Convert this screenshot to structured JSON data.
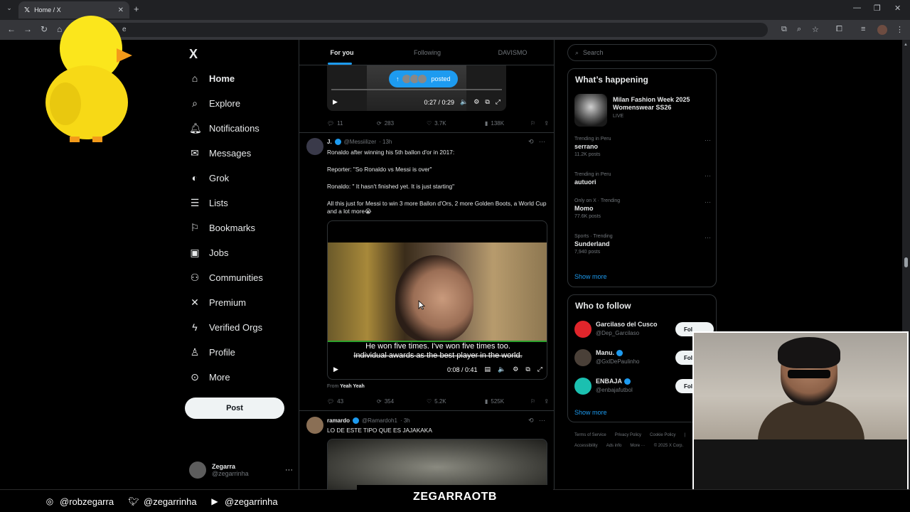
{
  "browser": {
    "tab_title": "Home / X",
    "tab_close": "✕",
    "new_tab": "+",
    "partial_url_text": "e"
  },
  "nav": {
    "logo": "X",
    "items": [
      {
        "label": "Home",
        "icon": "home-icon"
      },
      {
        "label": "Explore",
        "icon": "search-icon"
      },
      {
        "label": "Notifications",
        "icon": "bell-icon"
      },
      {
        "label": "Messages",
        "icon": "envelope-icon"
      },
      {
        "label": "Grok",
        "icon": "grok-icon"
      },
      {
        "label": "Lists",
        "icon": "list-icon"
      },
      {
        "label": "Bookmarks",
        "icon": "bookmark-icon"
      },
      {
        "label": "Jobs",
        "icon": "briefcase-icon"
      },
      {
        "label": "Communities",
        "icon": "people-icon"
      },
      {
        "label": "Premium",
        "icon": "x-icon"
      },
      {
        "label": "Verified Orgs",
        "icon": "lightning-icon"
      },
      {
        "label": "Profile",
        "icon": "person-icon"
      },
      {
        "label": "More",
        "icon": "more-circle-icon"
      }
    ],
    "post_button": "Post",
    "account": {
      "name": "Zegarra",
      "handle": "@zegarrinha",
      "more": "···"
    }
  },
  "timeline": {
    "tabs": [
      "For you",
      "Following",
      "DAVISMO"
    ],
    "active_tab": 0,
    "top_video": {
      "posted_label": "posted",
      "time": "0:27 / 0:29",
      "actions": {
        "replies": "11",
        "reposts": "283",
        "likes": "3.7K",
        "views": "138K"
      }
    },
    "tweet1": {
      "name": "J.",
      "handle": "@Messiilizer",
      "time": "· 13h",
      "text": [
        "Ronaldo after winning his 5th ballon d'or in 2017:",
        "Reporter: \"So Ronaldo vs Messi is over\"",
        "Ronaldo: \" It hasn't finished yet. It is just starting\"",
        "All this just for Messi to win 3 more Ballon d'Ors, 2 more Golden Boots, a World Cup and a lot more😭"
      ],
      "subtitle_1": "He won five times. I've won five times too.",
      "subtitle_2": "Individual awards as the best player in the world.",
      "video_time": "0:08 / 0:41",
      "from_prefix": "From",
      "from_name": "Yeah Yeah",
      "actions": {
        "replies": "43",
        "reposts": "354",
        "likes": "5.2K",
        "views": "525K"
      }
    },
    "tweet2": {
      "name": "ramardo",
      "handle": "@Ramardoh1",
      "time": "· 3h",
      "text": "LO DE ESTE TIPO QUE ES JAJAKAKA"
    }
  },
  "right": {
    "search_placeholder": "Search",
    "whats_happening_title": "What’s happening",
    "featured": {
      "title": "Milan Fashion Week 2025 Womenswear SS26",
      "status": "LIVE"
    },
    "trends": [
      {
        "context": "Trending in Peru",
        "title": "serrano",
        "count": "11.2K posts"
      },
      {
        "context": "Trending in Peru",
        "title": "autuori",
        "count": ""
      },
      {
        "context": "Only on X · Trending",
        "title": "Momo",
        "count": "77.6K posts"
      },
      {
        "context": "Sports · Trending",
        "title": "Sunderland",
        "count": "7,940 posts"
      }
    ],
    "show_more": "Show more",
    "who_to_follow_title": "Who to follow",
    "follow": [
      {
        "name": "Garcilaso del Cusco",
        "handle": "@Dep_Garcilaso",
        "verified": false,
        "color": "#e0252b"
      },
      {
        "name": "Manu.",
        "handle": "@GxlDePaulinho",
        "verified": true,
        "color": "#4a4038"
      },
      {
        "name": "ENBAJA",
        "handle": "@enbajafutbol",
        "verified": true,
        "color": "#1bc0b0"
      }
    ],
    "follow_label": "Fol",
    "footer": {
      "row1": [
        "Terms of Service",
        "Privacy Policy",
        "Cookie Policy",
        "|"
      ],
      "row2": [
        "Accessibility",
        "Ads info",
        "More ···",
        "© 2025 X Corp."
      ]
    }
  },
  "overlay": {
    "socials": [
      {
        "icon": "instagram-icon",
        "handle": "@robzegarra"
      },
      {
        "icon": "twitter-bird-icon",
        "handle": "@zegarrinha"
      },
      {
        "icon": "youtube-icon",
        "handle": "@zegarrinha"
      }
    ],
    "brand": "ZEGARRAOTB"
  },
  "colors": {
    "accent": "#1d9bf0",
    "bg": "#000000",
    "border": "#2f3336",
    "muted": "#71767b"
  }
}
